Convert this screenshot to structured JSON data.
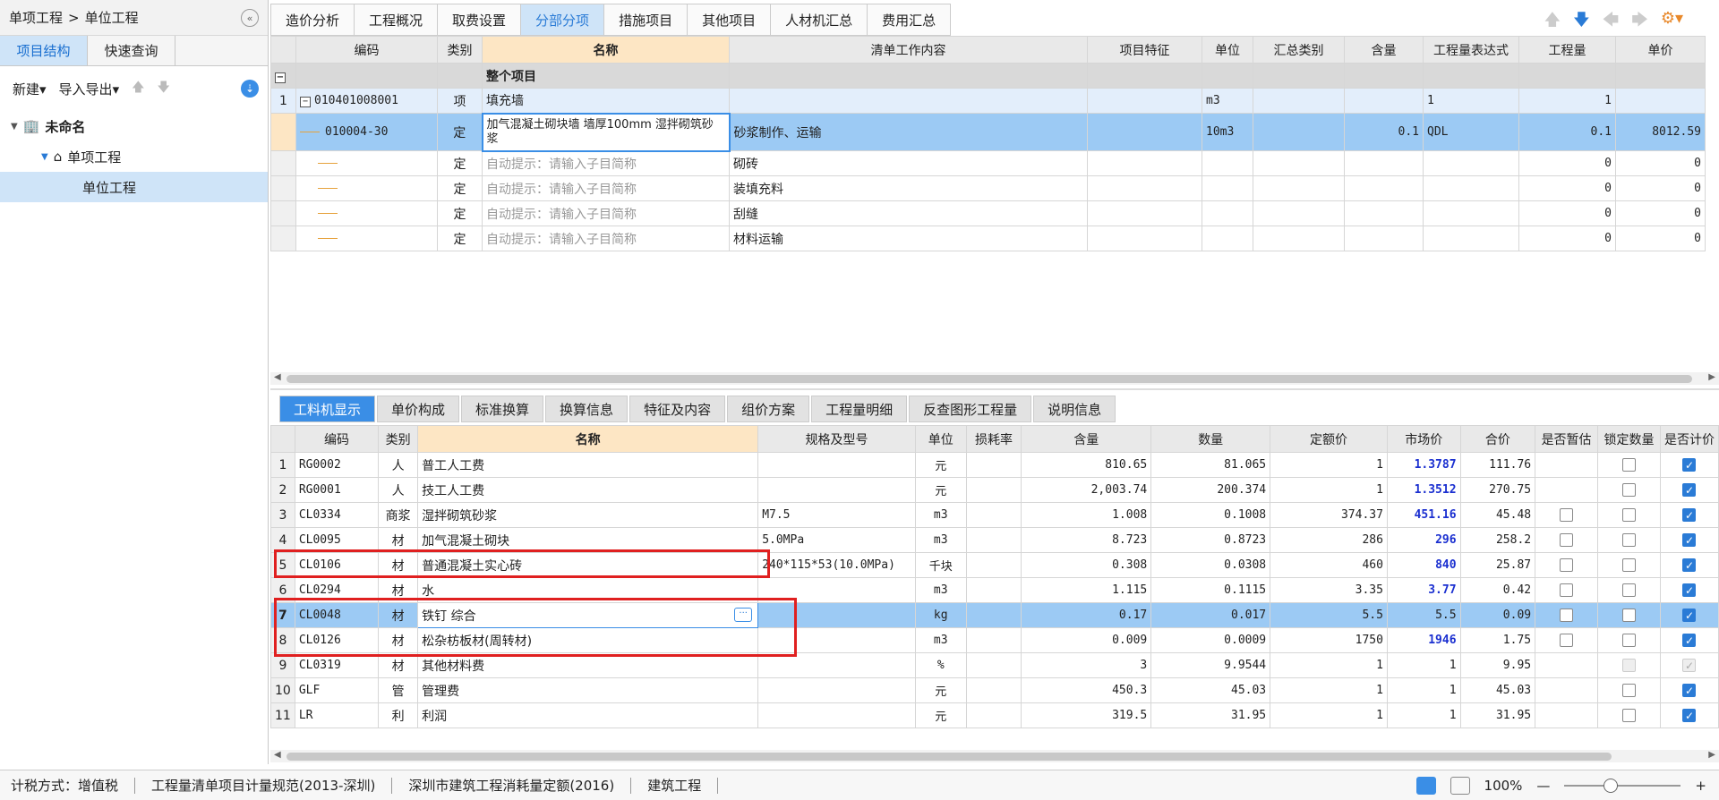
{
  "left": {
    "breadcrumb": [
      "单项工程",
      "单位工程"
    ],
    "breadcrumb_sep": ">",
    "tabs": [
      "项目结构",
      "快速查询"
    ],
    "toolbar": {
      "new": "新建",
      "import_export": "导入导出"
    },
    "tree": {
      "root": "未命名",
      "child": "单项工程",
      "leaf": "单位工程"
    }
  },
  "top_tabs": [
    "造价分析",
    "工程概况",
    "取费设置",
    "分部分项",
    "措施项目",
    "其他项目",
    "人材机汇总",
    "费用汇总"
  ],
  "top_grid": {
    "headers": [
      "编码",
      "类别",
      "名称",
      "清单工作内容",
      "项目特征",
      "单位",
      "汇总类别",
      "含量",
      "工程量表达式",
      "工程量",
      "单价"
    ],
    "section": "整个项目",
    "bill": {
      "no": "1",
      "code": "010401008001",
      "type": "项",
      "name": "填充墙",
      "unit": "m3",
      "expr": "1",
      "qty": "1"
    },
    "quota": {
      "code": "010004-30",
      "type": "定",
      "name": "加气混凝土砌块墙 墙厚100mm 湿拌砌筑砂浆",
      "content": "砂浆制作、运输",
      "unit": "10m3",
      "amount": "0.1",
      "expr": "QDL",
      "qty": "0.1",
      "price": "8012.59"
    },
    "subs": [
      {
        "type": "定",
        "hint": "自动提示：请输入子目简称",
        "content": "砌砖",
        "qty": "0",
        "price": "0"
      },
      {
        "type": "定",
        "hint": "自动提示：请输入子目简称",
        "content": "装填充料",
        "qty": "0",
        "price": "0"
      },
      {
        "type": "定",
        "hint": "自动提示：请输入子目简称",
        "content": "刮缝",
        "qty": "0",
        "price": "0"
      },
      {
        "type": "定",
        "hint": "自动提示：请输入子目简称",
        "content": "材料运输",
        "qty": "0",
        "price": "0"
      }
    ]
  },
  "bottom_tabs": [
    "工料机显示",
    "单价构成",
    "标准换算",
    "换算信息",
    "特征及内容",
    "组价方案",
    "工程量明细",
    "反查图形工程量",
    "说明信息"
  ],
  "bottom_grid": {
    "headers": [
      "编码",
      "类别",
      "名称",
      "规格及型号",
      "单位",
      "损耗率",
      "含量",
      "数量",
      "定额价",
      "市场价",
      "合价",
      "是否暂估",
      "锁定数量",
      "是否计价"
    ],
    "rows": [
      {
        "no": "1",
        "code": "RG0002",
        "type": "人",
        "name": "普工人工费",
        "spec": "",
        "unit": "元",
        "content": "810.65",
        "qty": "81.065",
        "quota": "1",
        "market": "1.3787",
        "total": "111.76",
        "est": "",
        "lock": "off",
        "priced": "on",
        "blue": true
      },
      {
        "no": "2",
        "code": "RG0001",
        "type": "人",
        "name": "技工人工费",
        "spec": "",
        "unit": "元",
        "content": "2,003.74",
        "qty": "200.374",
        "quota": "1",
        "market": "1.3512",
        "total": "270.75",
        "est": "",
        "lock": "off",
        "priced": "on",
        "blue": true
      },
      {
        "no": "3",
        "code": "CL0334",
        "type": "商浆",
        "name": "湿拌砌筑砂浆",
        "spec": "M7.5",
        "unit": "m3",
        "content": "1.008",
        "qty": "0.1008",
        "quota": "374.37",
        "market": "451.16",
        "total": "45.48",
        "est": "off",
        "lock": "off",
        "priced": "on",
        "blue": true
      },
      {
        "no": "4",
        "code": "CL0095",
        "type": "材",
        "name": "加气混凝土砌块",
        "spec": "5.0MPa",
        "unit": "m3",
        "content": "8.723",
        "qty": "0.8723",
        "quota": "286",
        "market": "296",
        "total": "258.2",
        "est": "off",
        "lock": "off",
        "priced": "on",
        "blue": true
      },
      {
        "no": "5",
        "code": "CL0106",
        "type": "材",
        "name": "普通混凝土实心砖",
        "spec": "240*115*53(10.0MPa)",
        "unit": "千块",
        "content": "0.308",
        "qty": "0.0308",
        "quota": "460",
        "market": "840",
        "total": "25.87",
        "est": "off",
        "lock": "off",
        "priced": "on",
        "blue": true
      },
      {
        "no": "6",
        "code": "CL0294",
        "type": "材",
        "name": "水",
        "spec": "",
        "unit": "m3",
        "content": "1.115",
        "qty": "0.1115",
        "quota": "3.35",
        "market": "3.77",
        "total": "0.42",
        "est": "off",
        "lock": "off",
        "priced": "on",
        "blue": true
      },
      {
        "no": "7",
        "code": "CL0048",
        "type": "材",
        "name": "铁钉 综合",
        "spec": "",
        "unit": "kg",
        "content": "0.17",
        "qty": "0.017",
        "quota": "5.5",
        "market": "5.5",
        "total": "0.09",
        "est": "off",
        "lock": "off",
        "priced": "on",
        "blue": false,
        "selected": true
      },
      {
        "no": "8",
        "code": "CL0126",
        "type": "材",
        "name": "松杂枋板材(周转材)",
        "spec": "",
        "unit": "m3",
        "content": "0.009",
        "qty": "0.0009",
        "quota": "1750",
        "market": "1946",
        "total": "1.75",
        "est": "off",
        "lock": "off",
        "priced": "on",
        "blue": true
      },
      {
        "no": "9",
        "code": "CL0319",
        "type": "材",
        "name": "其他材料费",
        "spec": "",
        "unit": "%",
        "content": "3",
        "qty": "9.9544",
        "quota": "1",
        "market": "1",
        "total": "9.95",
        "est": "",
        "lock": "dis",
        "priced": "dison",
        "blue": false
      },
      {
        "no": "10",
        "code": "GLF",
        "type": "管",
        "name": "管理费",
        "spec": "",
        "unit": "元",
        "content": "450.3",
        "qty": "45.03",
        "quota": "1",
        "market": "1",
        "total": "45.03",
        "est": "",
        "lock": "off",
        "priced": "on",
        "blue": false
      },
      {
        "no": "11",
        "code": "LR",
        "type": "利",
        "name": "利润",
        "spec": "",
        "unit": "元",
        "content": "319.5",
        "qty": "31.95",
        "quota": "1",
        "market": "1",
        "total": "31.95",
        "est": "",
        "lock": "off",
        "priced": "on",
        "blue": false
      }
    ]
  },
  "status": {
    "tax": "计税方式：增值税",
    "spec": "工程量清单项目计量规范(2013-深圳)",
    "quota": "深圳市建筑工程消耗量定额(2016)",
    "discipline": "建筑工程",
    "zoom": "100%"
  },
  "colors": {
    "accent": "#3a8ee6",
    "selected_row": "#9ccaf4",
    "highlight_red": "#e02020",
    "header_orange": "#fde6c4"
  }
}
